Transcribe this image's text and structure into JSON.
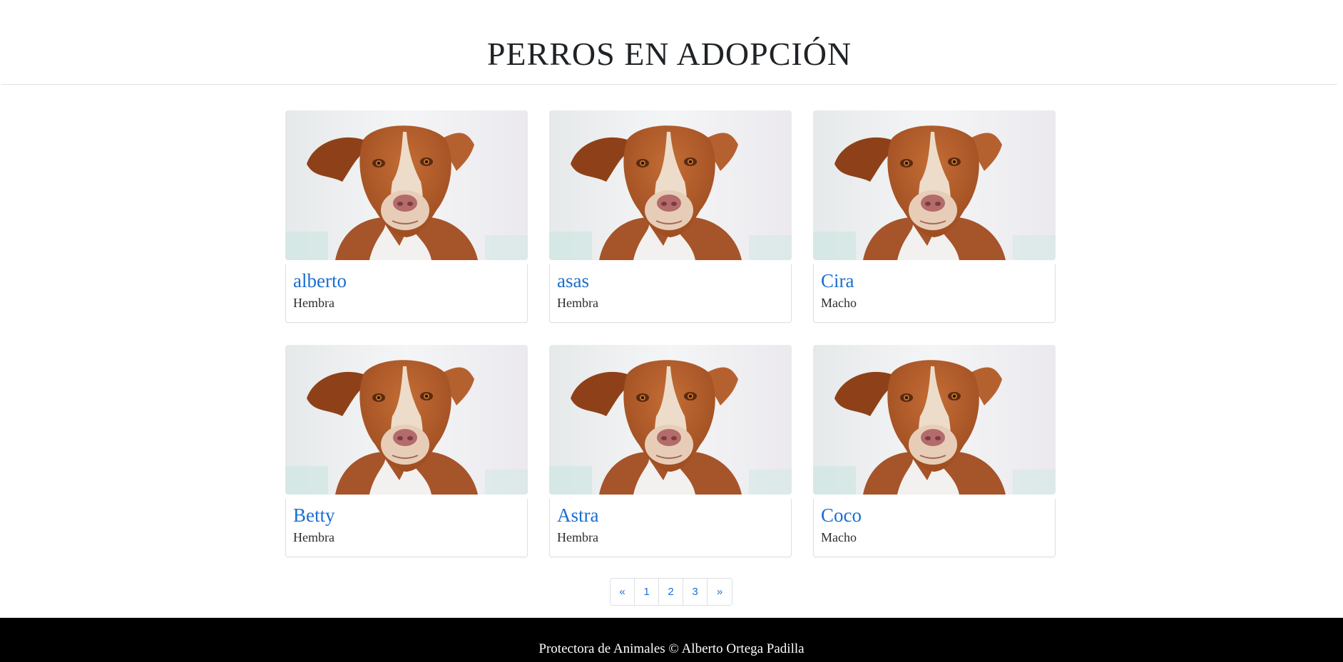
{
  "header": {
    "title": "PERROS EN ADOPCIÓN"
  },
  "dogs": [
    {
      "name": "alberto",
      "sex": "Hembra",
      "photo_icon": "dog-photo"
    },
    {
      "name": "asas",
      "sex": "Hembra",
      "photo_icon": "dog-photo"
    },
    {
      "name": "Cira",
      "sex": "Macho",
      "photo_icon": "dog-photo"
    },
    {
      "name": "Betty",
      "sex": "Hembra",
      "photo_icon": "dog-photo"
    },
    {
      "name": "Astra",
      "sex": "Hembra",
      "photo_icon": "dog-photo"
    },
    {
      "name": "Coco",
      "sex": "Macho",
      "photo_icon": "dog-photo"
    }
  ],
  "pagination": {
    "prev": "«",
    "pages": [
      "1",
      "2",
      "3"
    ],
    "next": "»"
  },
  "footer": {
    "text": "Protectora de Animales © Alberto Ortega Padilla"
  },
  "colors": {
    "link": "#1a6fd1",
    "footer_bg": "#000000",
    "border": "#dcdfe3"
  }
}
